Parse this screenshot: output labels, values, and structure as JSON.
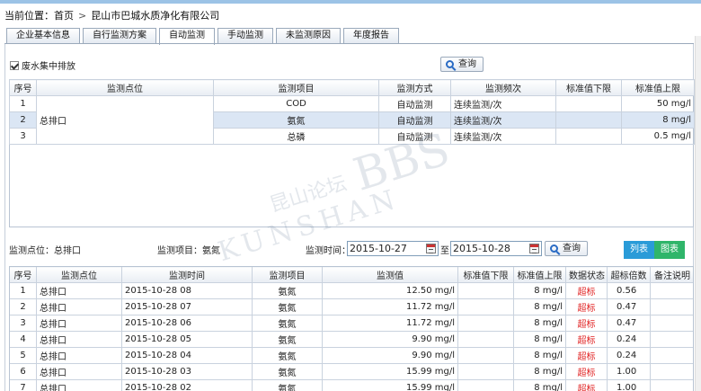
{
  "breadcrumb": {
    "label": "当前位置：",
    "home": "首页",
    "sep": ">",
    "company": "昆山市巴城水质净化有限公司"
  },
  "tabs": [
    "企业基本信息",
    "自行监测方案",
    "自动监测",
    "手动监测",
    "未监测原因",
    "年度报告"
  ],
  "active_tab": 2,
  "checkbox_label": "废水集中排放",
  "query_label": "查询",
  "table1": {
    "headers": [
      "序号",
      "监测点位",
      "监测项目",
      "监测方式",
      "监测频次",
      "标准值下限",
      "标准值上限"
    ],
    "point": "总排口",
    "rows": [
      {
        "no": "1",
        "item": "COD",
        "method": "自动监测",
        "freq": "连续监测/次",
        "low": "",
        "high": "50 mg/l"
      },
      {
        "no": "2",
        "item": "氨氮",
        "method": "自动监测",
        "freq": "连续监测/次",
        "low": "",
        "high": "8 mg/l"
      },
      {
        "no": "3",
        "item": "总磷",
        "method": "自动监测",
        "freq": "连续监测/次",
        "low": "",
        "high": "0.5 mg/l"
      }
    ]
  },
  "filter": {
    "point_label": "监测点位：总排口",
    "item_label": "监测项目：氨氮",
    "time_label": "监测时间：",
    "date_from": "2015-10-27",
    "to": "至",
    "date_to": "2015-10-28",
    "view_list": "列表",
    "view_chart": "图表"
  },
  "colors": {
    "list_btn": "#2a9bd8",
    "chart_btn": "#2fb56a",
    "exceed": "#e02020"
  },
  "table2": {
    "headers": [
      "序号",
      "监测点位",
      "监测时间",
      "监测项目",
      "监测值",
      "标准值下限",
      "标准值上限",
      "数据状态",
      "超标倍数",
      "备注说明"
    ],
    "rows": [
      {
        "no": "1",
        "point": "总排口",
        "time": "2015-10-28 08",
        "item": "氨氮",
        "value": "12.50  mg/l",
        "low": "",
        "high": "8 mg/l",
        "status": "超标",
        "times": "0.56",
        "note": ""
      },
      {
        "no": "2",
        "point": "总排口",
        "time": "2015-10-28 07",
        "item": "氨氮",
        "value": "11.72  mg/l",
        "low": "",
        "high": "8 mg/l",
        "status": "超标",
        "times": "0.47",
        "note": ""
      },
      {
        "no": "3",
        "point": "总排口",
        "time": "2015-10-28 06",
        "item": "氨氮",
        "value": "11.72  mg/l",
        "low": "",
        "high": "8 mg/l",
        "status": "超标",
        "times": "0.47",
        "note": ""
      },
      {
        "no": "4",
        "point": "总排口",
        "time": "2015-10-28 05",
        "item": "氨氮",
        "value": "9.90  mg/l",
        "low": "",
        "high": "8 mg/l",
        "status": "超标",
        "times": "0.24",
        "note": ""
      },
      {
        "no": "5",
        "point": "总排口",
        "time": "2015-10-28 04",
        "item": "氨氮",
        "value": "9.90  mg/l",
        "low": "",
        "high": "8 mg/l",
        "status": "超标",
        "times": "0.24",
        "note": ""
      },
      {
        "no": "6",
        "point": "总排口",
        "time": "2015-10-28 03",
        "item": "氨氮",
        "value": "15.99  mg/l",
        "low": "",
        "high": "8 mg/l",
        "status": "超标",
        "times": "1.00",
        "note": ""
      },
      {
        "no": "7",
        "point": "总排口",
        "time": "2015-10-28 02",
        "item": "氨氮",
        "value": "15.99  mg/l",
        "low": "",
        "high": "8 mg/l",
        "status": "超标",
        "times": "1.00",
        "note": ""
      }
    ]
  },
  "watermark": {
    "cn": "昆山论坛",
    "en": "KUNSHAN",
    "logo": "BBS"
  }
}
